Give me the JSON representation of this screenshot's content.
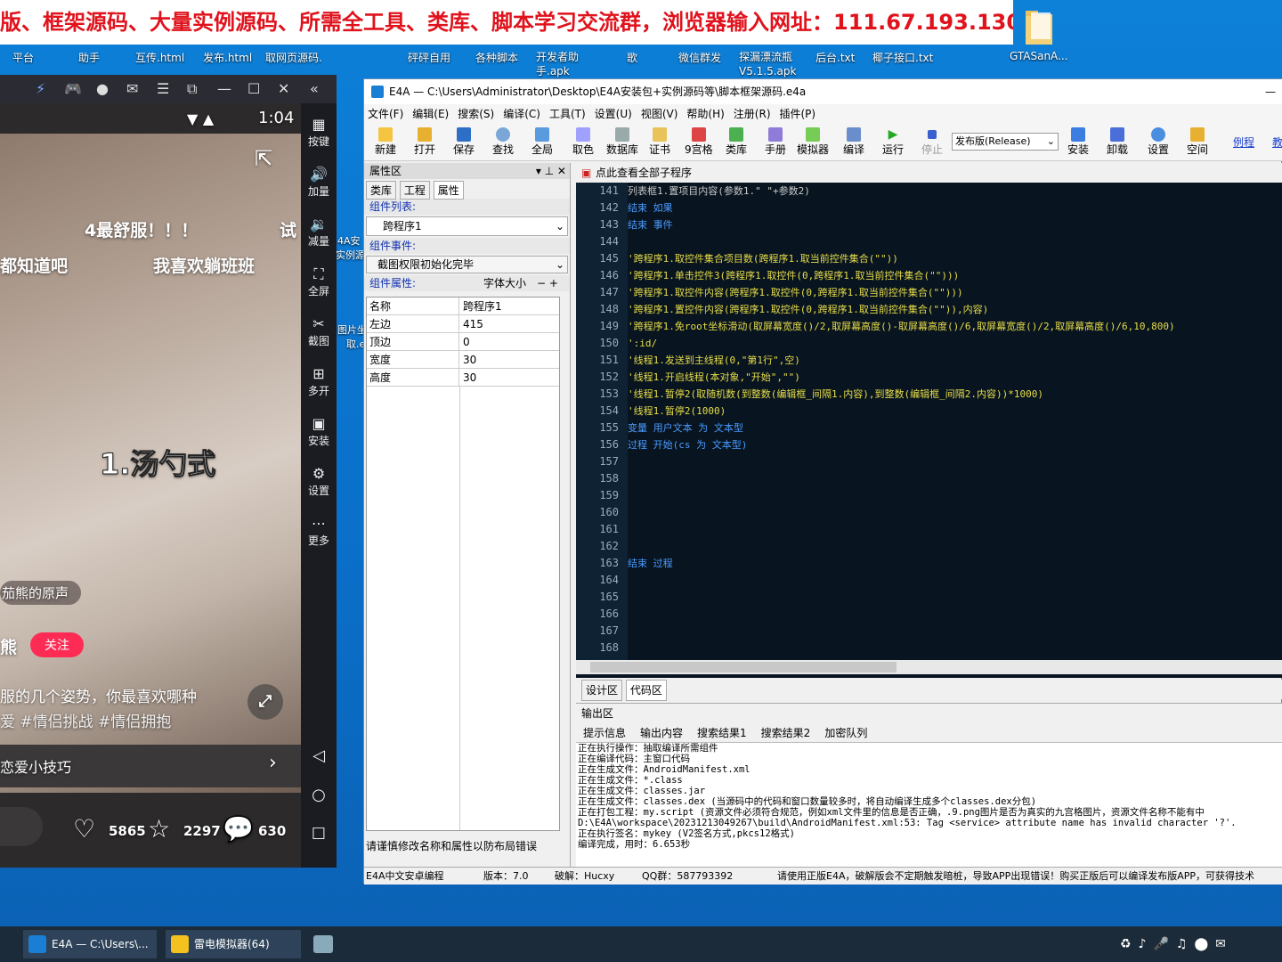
{
  "banner": {
    "text": "版、框架源码、大量实例源码、所需全工具、类库、脚本学习交流群，浏览器输入网址：111.67.193.130"
  },
  "desktop_icons": [
    "平台",
    "助手",
    "互传.html",
    "发布.html",
    "取网页源码.",
    "砰砰自用",
    "各种脚本",
    "开发者助手.apk",
    "歌",
    "微信群发",
    "探漏漂流瓶V5.1.5.apk",
    "后台.txt",
    "椰子接口.txt",
    "GTASanA..."
  ],
  "desktop_mid_labels": {
    "a": "4A安",
    "b": "实例源",
    "c": "图片坐",
    "d": "取.e"
  },
  "phone": {
    "time": "1:04",
    "overlay1": "4最舒服！！！",
    "overlay1b": "试",
    "overlay2a": "都知道吧",
    "overlay2b": "我喜欢躺班班",
    "sticker": "1.汤勺式",
    "sound": "茄熊的原声",
    "author": "熊",
    "follow": "关注",
    "desc1": "服的几个姿势，你最喜欢哪种",
    "desc2": "爱 #情侣挑战 #情侣拥抱",
    "tip": "恋爱小技巧",
    "likes": "5865",
    "favs": "2297",
    "comments": "630"
  },
  "emu_side": [
    "按键",
    "加量",
    "减量",
    "全屏",
    "截图",
    "多开",
    "安装",
    "设置",
    "更多"
  ],
  "ide": {
    "title": "E4A — C:\\Users\\Administrator\\Desktop\\E4A安装包+实例源码等\\脚本框架源码.e4a",
    "menus": [
      "文件(F)",
      "编辑(E)",
      "搜索(S)",
      "编译(C)",
      "工具(T)",
      "设置(U)",
      "视图(V)",
      "帮助(H)",
      "注册(R)",
      "插件(P)"
    ],
    "toolbar": [
      "新建",
      "打开",
      "保存",
      "查找",
      "全局",
      "取色",
      "数据库",
      "证书",
      "9宫格",
      "类库",
      "手册",
      "模拟器",
      "编译",
      "运行",
      "停止",
      "安装",
      "卸载",
      "设置",
      "空间",
      "例程",
      "教"
    ],
    "release_select": "发布版(Release)",
    "props_title": "属性区",
    "props_tabs": [
      "类库",
      "工程",
      "属性"
    ],
    "comp_list_label": "组件列表:",
    "comp_list_value": "跨程序1",
    "comp_event_label": "组件事件:",
    "comp_event_value": "截图权限初始化完毕",
    "comp_attr_label": "组件属性:",
    "font_size": "字体大小",
    "rows": [
      {
        "k": "名称",
        "v": "跨程序1"
      },
      {
        "k": "左边",
        "v": "415"
      },
      {
        "k": "顶边",
        "v": "0"
      },
      {
        "k": "宽度",
        "v": "30"
      },
      {
        "k": "高度",
        "v": "30"
      }
    ],
    "props_hint": "请谨慎修改名称和属性以防布局错误",
    "code_tab": "点此查看全部子程序",
    "gutter": [
      "141",
      "142",
      "143",
      "144",
      "145",
      "146",
      "147",
      "148",
      "149",
      "150",
      "151",
      "152",
      "153",
      "154",
      "155",
      "156",
      "157",
      "158",
      "159",
      "160",
      "161",
      "162",
      "163",
      "164",
      "165",
      "166",
      "167",
      "168"
    ],
    "code": [
      {
        "t": "        列表框1.置项目内容(参数1.\" \"+参数2)",
        "c": "#c8c8c8"
      },
      {
        "t": "    结束 如果",
        "c": "#4a9bff"
      },
      {
        "t": "结束 事件",
        "c": "#4a9bff"
      },
      {
        "t": "",
        "c": "#fff"
      },
      {
        "t": "    '跨程序1.取控件集合项目数(跨程序1.取当前控件集合(\"\"))",
        "c": "#e7dd4a"
      },
      {
        "t": "    '跨程序1.单击控件3(跨程序1.取控件(0,跨程序1.取当前控件集合(\"\")))",
        "c": "#e7dd4a"
      },
      {
        "t": "    '跨程序1.取控件内容(跨程序1.取控件(0,跨程序1.取当前控件集合(\"\")))",
        "c": "#e7dd4a"
      },
      {
        "t": "    '跨程序1.置控件内容(跨程序1.取控件(0,跨程序1.取当前控件集合(\"\")),内容)",
        "c": "#e7dd4a"
      },
      {
        "t": "    '跨程序1.免root坐标滑动(取屏幕宽度()/2,取屏幕高度()-取屏幕高度()/6,取屏幕宽度()/2,取屏幕高度()/6,10,800)",
        "c": "#e7dd4a"
      },
      {
        "t": "    ':id/",
        "c": "#e7dd4a"
      },
      {
        "t": "    '线程1.发送到主线程(0,\"第1行\",空)",
        "c": "#e7dd4a"
      },
      {
        "t": "    '线程1.开启线程(本对象,\"开始\",\"\")",
        "c": "#e7dd4a"
      },
      {
        "t": "    '线程1.暂停2(取随机数(到整数(编辑框_间隔1.内容),到整数(编辑框_间隔2.内容))*1000)",
        "c": "#e7dd4a"
      },
      {
        "t": "    '线程1.暂停2(1000)",
        "c": "#e7dd4a"
      },
      {
        "t": "    变量 用户文本 为 文本型",
        "c": "#4a9bff"
      },
      {
        "t": "过程 开始(cs 为 文本型)",
        "c": "#4a9bff"
      },
      {
        "t": "",
        "c": "#fff"
      },
      {
        "t": "",
        "c": "#fff"
      },
      {
        "t": "",
        "c": "#fff"
      },
      {
        "t": "",
        "c": "#fff"
      },
      {
        "t": "",
        "c": "#fff"
      },
      {
        "t": "",
        "c": "#fff"
      },
      {
        "t": "结束 过程",
        "c": "#4a9bff"
      },
      {
        "t": "",
        "c": "#fff"
      },
      {
        "t": "",
        "c": "#fff"
      },
      {
        "t": "",
        "c": "#fff"
      },
      {
        "t": "",
        "c": "#fff"
      },
      {
        "t": "",
        "c": "#fff"
      }
    ],
    "design_tab": "设计区",
    "code_area_tab": "代码区",
    "output_title": "输出区",
    "out_tabs": [
      "提示信息",
      "输出内容",
      "搜索结果1",
      "搜索结果2",
      "加密队列"
    ],
    "out_lines": [
      "正在执行操作：抽取编译所需组件",
      "正在编译代码：主窗口代码",
      "正在生成文件：AndroidManifest.xml",
      "正在生成文件：*.class",
      "正在生成文件：classes.jar",
      "正在生成文件：classes.dex  (当源码中的代码和窗口数量较多时，将自动编译生成多个classes.dex分包)",
      "正在打包工程：my.script  (资源文件必须符合规范，例如xml文件里的信息是否正确，.9.png图片是否为真实的九宫格图片，资源文件名称不能有中",
      "D:\\E4A\\workspace\\20231213049267\\build\\AndroidManifest.xml:53: Tag <service> attribute name has invalid character '?'.",
      "正在执行签名：mykey  (V2签名方式,pkcs12格式)",
      "编译完成，用时：6.653秒"
    ],
    "status": [
      "E4A中文安卓编程",
      "版本：7.0",
      "破解：Hucxy",
      "QQ群：587793392",
      "请使用正版E4A，破解版会不定期触发暗桩，导致APP出现错误！购买正版后可以编译发布版APP，可获得技术"
    ]
  },
  "taskbar": {
    "item1": "E4A — C:\\Users\\...",
    "item2": "雷电模拟器(64)"
  }
}
